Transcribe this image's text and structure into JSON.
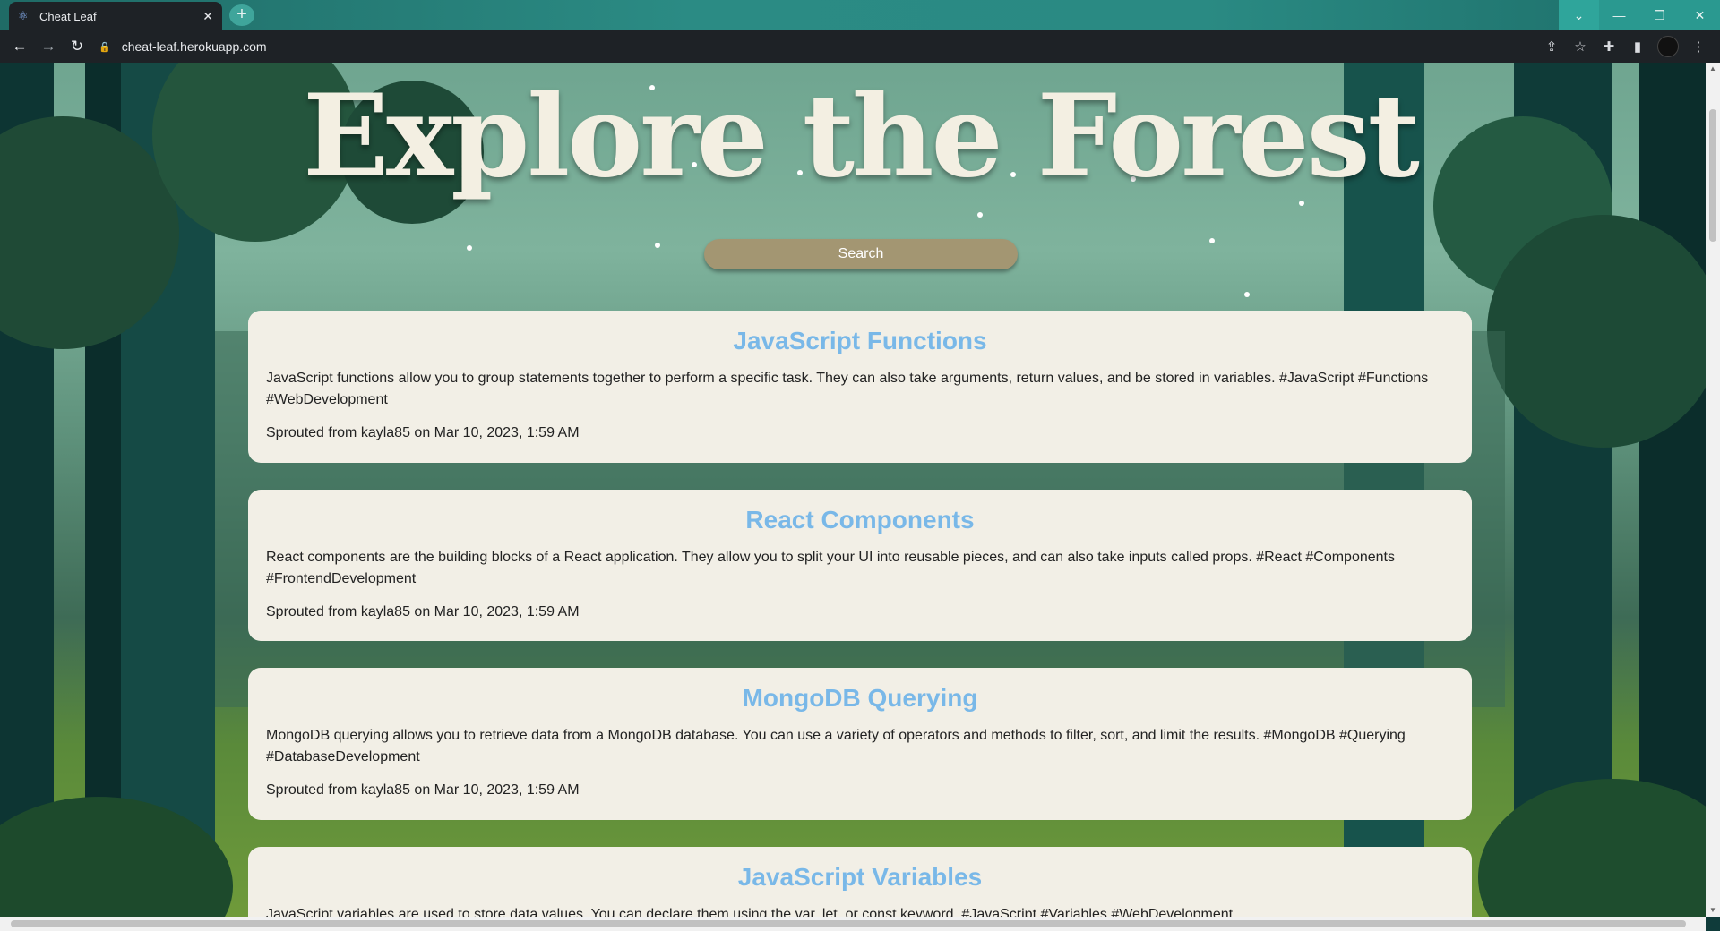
{
  "browser": {
    "tab_title": "Cheat Leaf",
    "url": "cheat-leaf.herokuapp.com"
  },
  "hero": {
    "title": "Explore the Forest",
    "search_label": "Search"
  },
  "posts": [
    {
      "title": "JavaScript Functions",
      "body": "JavaScript functions allow you to group statements together to perform a specific task. They can also take arguments, return values, and be stored in variables. #JavaScript #Functions #WebDevelopment",
      "meta": "Sprouted from kayla85 on Mar 10, 2023, 1:59 AM"
    },
    {
      "title": "React Components",
      "body": "React components are the building blocks of a React application. They allow you to split your UI into reusable pieces, and can also take inputs called props. #React #Components #FrontendDevelopment",
      "meta": "Sprouted from kayla85 on Mar 10, 2023, 1:59 AM"
    },
    {
      "title": "MongoDB Querying",
      "body": "MongoDB querying allows you to retrieve data from a MongoDB database. You can use a variety of operators and methods to filter, sort, and limit the results. #MongoDB #Querying #DatabaseDevelopment",
      "meta": "Sprouted from kayla85 on Mar 10, 2023, 1:59 AM"
    },
    {
      "title": "JavaScript Variables",
      "body": "JavaScript variables are used to store data values. You can declare them using the var, let, or const keyword. #JavaScript #Variables #WebDevelopment"
    }
  ],
  "colors": {
    "card_title": "#79b8e8",
    "card_bg": "#f2efe6",
    "search_button": "#a39672",
    "hero_title": "#f3efe2"
  }
}
